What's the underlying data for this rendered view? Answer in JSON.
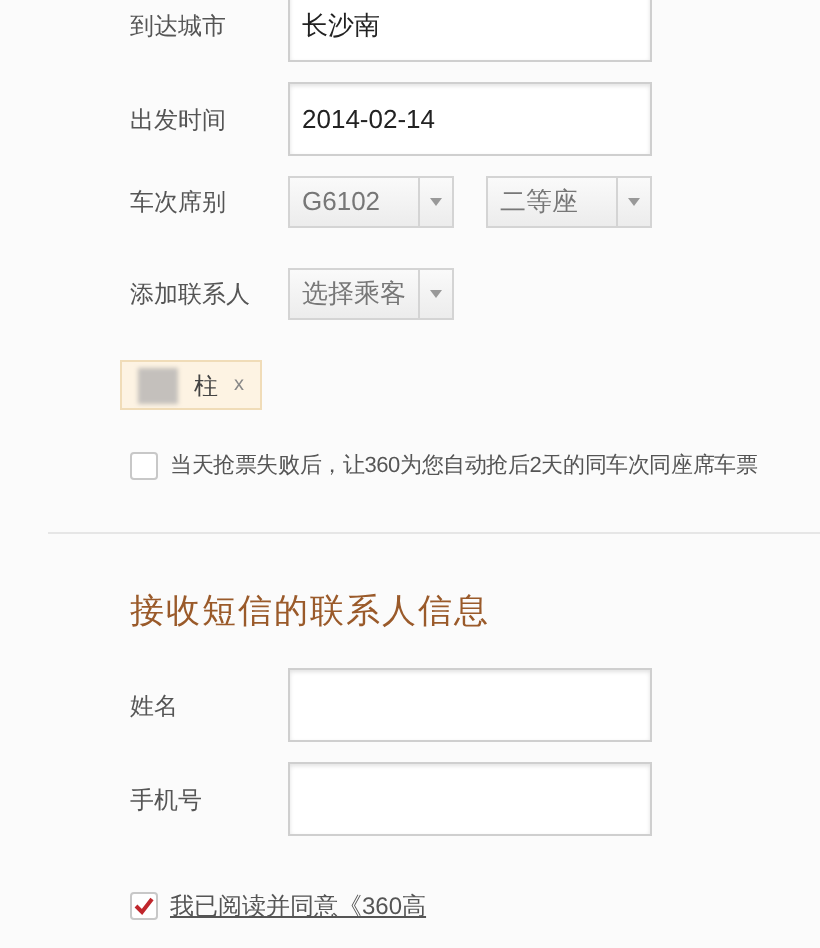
{
  "trip_form": {
    "fields": [
      {
        "kind": "input",
        "label": "到达城市",
        "value": "长沙南"
      },
      {
        "kind": "input",
        "label": "出发时间",
        "value": "2014-02-14"
      },
      {
        "kind": "selects",
        "label": "车次席别",
        "options": [
          "G6102",
          "二等座"
        ]
      },
      {
        "kind": "selects",
        "label": "添加联系人",
        "options": [
          "选择乘客"
        ]
      }
    ],
    "passenger_tags": [
      {
        "name": "柱",
        "remove": "x"
      }
    ],
    "auto_grab": {
      "label": "当天抢票失败后，让360为您自动抢后2天的同车次同座席车票",
      "checked": false
    }
  },
  "sms_contact": {
    "title": "接收短信的联系人信息",
    "fields": [
      {
        "label": "姓名"
      },
      {
        "label": "手机号"
      }
    ]
  },
  "agreement": {
    "label": "我已阅读并同意《360高",
    "checked": true
  }
}
